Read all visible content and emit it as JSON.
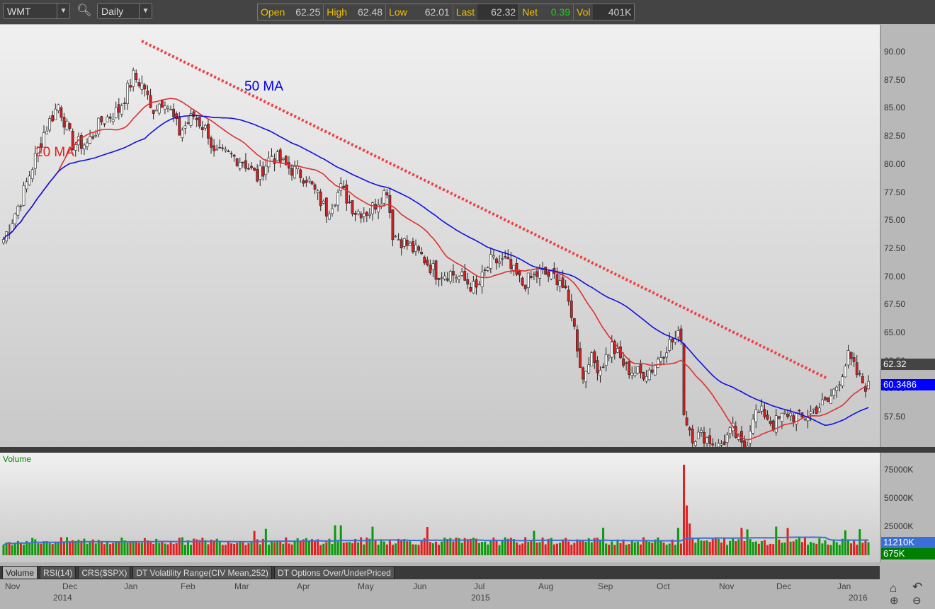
{
  "toolbar": {
    "symbol": "WMT",
    "interval": "Daily",
    "quote": {
      "open_label": "Open",
      "open": "62.25",
      "high_label": "High",
      "high": "62.48",
      "low_label": "Low",
      "low": "62.01",
      "last_label": "Last",
      "last": "62.32",
      "net_label": "Net",
      "net": "0.39",
      "vol_label": "Vol",
      "vol": "401K"
    }
  },
  "price_axis": {
    "ticks": [
      "90.00",
      "87.50",
      "85.00",
      "82.50",
      "80.00",
      "77.50",
      "75.00",
      "72.50",
      "70.00",
      "67.50",
      "65.00",
      "62.50",
      "60.00",
      "57.50"
    ],
    "last_badge": "62.32",
    "ma_badge": "60.3486",
    "last_color": "#444444",
    "ma_color": "#0000ff"
  },
  "annotations": {
    "ma50": "50 MA",
    "ma20": "20 MA"
  },
  "volume": {
    "title": "Volume",
    "ticks": [
      "75000K",
      "50000K",
      "25000K"
    ],
    "avg_badge": "11210K",
    "last_badge": "675K"
  },
  "tabs": [
    "Volume",
    "RSI(14)",
    "CRS($SPX)",
    "DT Volatility Range(CIV Mean,252)",
    "DT Options Over/UnderPriced"
  ],
  "x_axis": {
    "months": [
      "Nov",
      "Dec",
      "Jan",
      "Feb",
      "Mar",
      "Apr",
      "May",
      "Jun",
      "Jul",
      "Aug",
      "Sep",
      "Oct",
      "Nov",
      "Dec",
      "Jan"
    ],
    "years": [
      "2014",
      "2015",
      "2016"
    ]
  },
  "chart_data": {
    "type": "candlestick",
    "symbol": "WMT",
    "interval": "Daily",
    "ylim": [
      55.5,
      92.5
    ],
    "approx_closes": [
      [
        0,
        75.5
      ],
      [
        6,
        79
      ],
      [
        10,
        82
      ],
      [
        14,
        85
      ],
      [
        19,
        87.5
      ],
      [
        24,
        84
      ],
      [
        29,
        84
      ],
      [
        34,
        86
      ],
      [
        40,
        87
      ],
      [
        45,
        90
      ],
      [
        49,
        89
      ],
      [
        51,
        87
      ],
      [
        56,
        88
      ],
      [
        61,
        85
      ],
      [
        66,
        86.5
      ],
      [
        71,
        85
      ],
      [
        73,
        83
      ],
      [
        78,
        83
      ],
      [
        83,
        82.5
      ],
      [
        88,
        81
      ],
      [
        93,
        83
      ],
      [
        98,
        82
      ],
      [
        105,
        81
      ],
      [
        112,
        78
      ],
      [
        117,
        80
      ],
      [
        122,
        78
      ],
      [
        127,
        78
      ],
      [
        133,
        80
      ],
      [
        135,
        76
      ],
      [
        140,
        75
      ],
      [
        145,
        74
      ],
      [
        150,
        72.5
      ],
      [
        155,
        72.5
      ],
      [
        159,
        72
      ],
      [
        164,
        71
      ],
      [
        169,
        73.5
      ],
      [
        174,
        73.5
      ],
      [
        180,
        71.5
      ],
      [
        186,
        72.5
      ],
      [
        193,
        72
      ],
      [
        197,
        69
      ],
      [
        201,
        63
      ],
      [
        203,
        65
      ],
      [
        207,
        64
      ],
      [
        211,
        66
      ],
      [
        216,
        64
      ],
      [
        221,
        63.5
      ],
      [
        225,
        64
      ],
      [
        230,
        66
      ],
      [
        235,
        67
      ],
      [
        236,
        60
      ],
      [
        239,
        58
      ],
      [
        243,
        58
      ],
      [
        248,
        57
      ],
      [
        253,
        58.5
      ],
      [
        257,
        56.5
      ],
      [
        260,
        60
      ],
      [
        264,
        60
      ],
      [
        267,
        59
      ],
      [
        272,
        60
      ],
      [
        277,
        59.5
      ],
      [
        282,
        60.5
      ],
      [
        286,
        61
      ],
      [
        289,
        62.5
      ],
      [
        293,
        65
      ],
      [
        297,
        63
      ],
      [
        300,
        62.3
      ]
    ],
    "volume_spike_k": 80000,
    "ma20_last": 61.8,
    "ma50_last": 60.3486
  }
}
